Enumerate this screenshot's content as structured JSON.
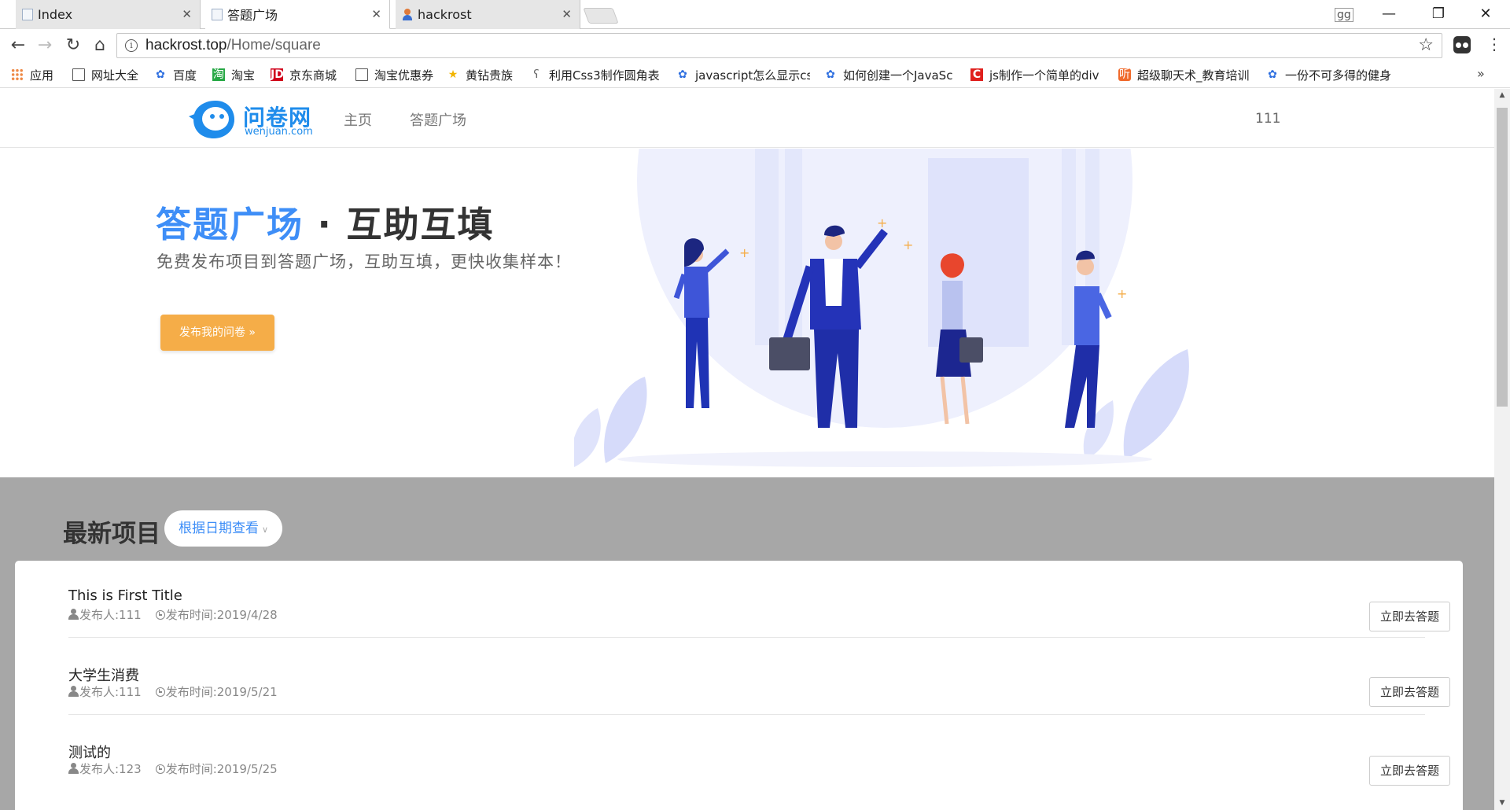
{
  "browser": {
    "tabs": [
      {
        "title": "Index"
      },
      {
        "title": "答题广场"
      },
      {
        "title": "hackrost"
      }
    ],
    "profile": "gg",
    "url_host": "hackrost.top",
    "url_path": "/Home/square",
    "bookmarks": [
      {
        "label": "应用",
        "icon": "apps-icon"
      },
      {
        "label": "网址大全",
        "icon": "page-icon"
      },
      {
        "label": "百度",
        "icon": "paw-icon"
      },
      {
        "label": "淘宝",
        "icon": "taobao-icon"
      },
      {
        "label": "京东商城",
        "icon": "jd-icon"
      },
      {
        "label": "淘宝优惠券",
        "icon": "page-icon"
      },
      {
        "label": "黄钻贵族",
        "icon": "star-icon"
      },
      {
        "label": "利用Css3制作圆角表",
        "icon": "hook-icon"
      },
      {
        "label": "javascript怎么显示cs",
        "icon": "paw-icon"
      },
      {
        "label": "如何创建一个JavaSc",
        "icon": "paw-icon"
      },
      {
        "label": "js制作一个简单的div",
        "icon": "c-icon"
      },
      {
        "label": "超级聊天术_教育培训",
        "icon": "ting-icon"
      },
      {
        "label": "一份不可多得的健身",
        "icon": "paw-icon"
      }
    ]
  },
  "site": {
    "logo_text": "问卷网",
    "logo_sub": "wenjuan.com",
    "nav": [
      "主页",
      "答题广场"
    ],
    "user": "111"
  },
  "hero": {
    "title_blue": "答题广场",
    "title_dot": " · ",
    "title_rest": "互助互填",
    "subtitle": "免费发布项目到答题广场，互助互填，更快收集样本！",
    "button": "发布我的问卷 »"
  },
  "projects": {
    "heading": "最新项目",
    "filter": "根据日期查看",
    "items": [
      {
        "title": "This is First Title",
        "author_label": "发布人:111",
        "time_label": "发布时间:2019/4/28",
        "action": "立即去答题"
      },
      {
        "title": "大学生消费",
        "author_label": "发布人:111",
        "time_label": "发布时间:2019/5/21",
        "action": "立即去答题"
      },
      {
        "title": "测试的",
        "author_label": "发布人:123",
        "time_label": "发布时间:2019/5/25",
        "action": "立即去答题"
      }
    ]
  },
  "colors": {
    "brand_blue": "#1f8ceb",
    "title_blue": "#3e8ef7",
    "cta_orange": "#f5ad48",
    "section_gray": "#a7a7a7"
  }
}
